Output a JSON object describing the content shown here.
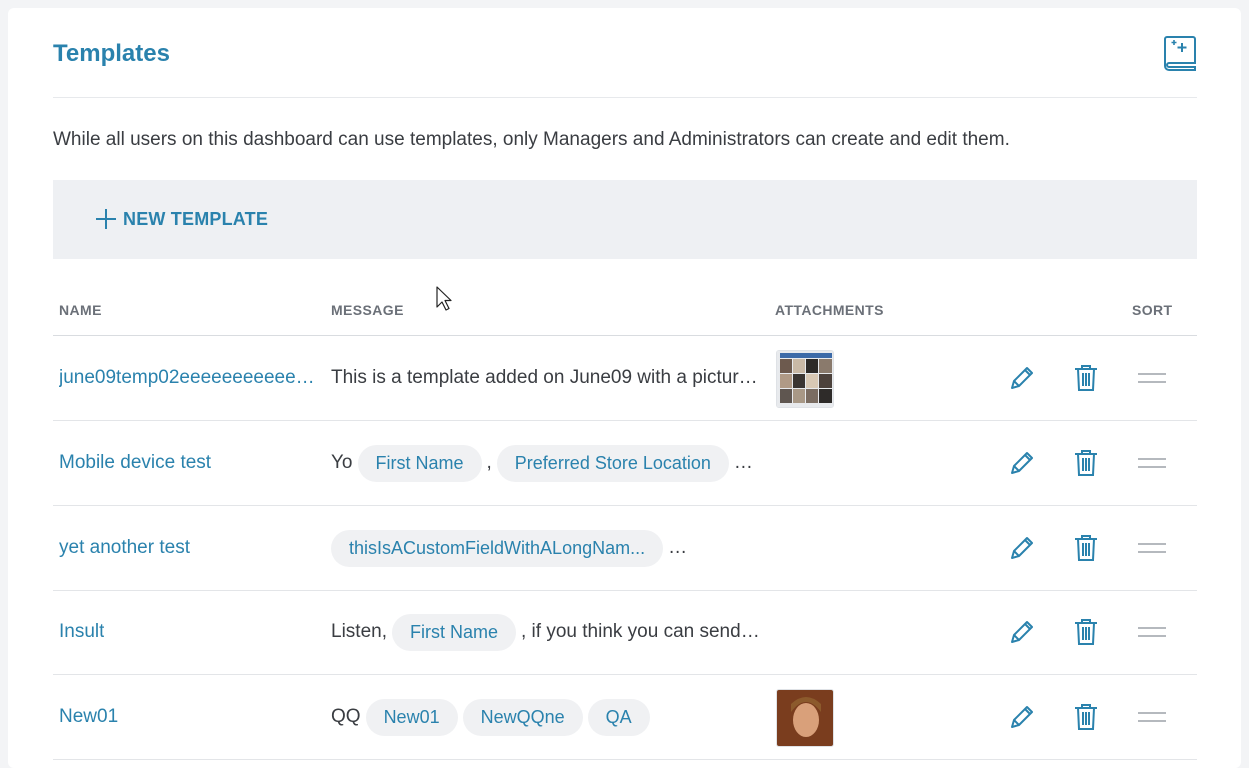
{
  "page": {
    "title": "Templates",
    "description": "While all users on this dashboard can use templates, only Managers and Administrators can create and edit them.",
    "new_template_label": "NEW TEMPLATE"
  },
  "table": {
    "headers": {
      "name": "NAME",
      "message": "MESSAGE",
      "attachments": "ATTACHMENTS",
      "sort": "SORT"
    },
    "rows": [
      {
        "name": "june09temp02eeeeeeeeeeeeeeee",
        "message_text": "This is a template added on June09 with a pictur…",
        "has_attachment": true
      },
      {
        "name": "Mobile device test",
        "prefix": "Yo",
        "chips": [
          "First Name",
          "Preferred Store Location"
        ],
        "separator": ",",
        "suffix": "…"
      },
      {
        "name": "yet another test",
        "chips": [
          "thisIsACustomFieldWithALongNam..."
        ],
        "suffix": "…"
      },
      {
        "name": "Insult",
        "prefix": "Listen,",
        "chips": [
          "First Name"
        ],
        "suffix": ", if you think you can send…"
      },
      {
        "name": "New01",
        "prefix": "QQ",
        "chips": [
          "New01",
          "NewQQne",
          "QA"
        ],
        "has_attachment": true
      }
    ]
  },
  "colors": {
    "accent": "#2a82ad",
    "toolbar_bg": "#eef0f3",
    "chip_bg": "#f0f1f3"
  },
  "icons": [
    "add-template-icon",
    "plus-icon",
    "pencil-icon",
    "trash-icon",
    "drag-handle-icon"
  ]
}
